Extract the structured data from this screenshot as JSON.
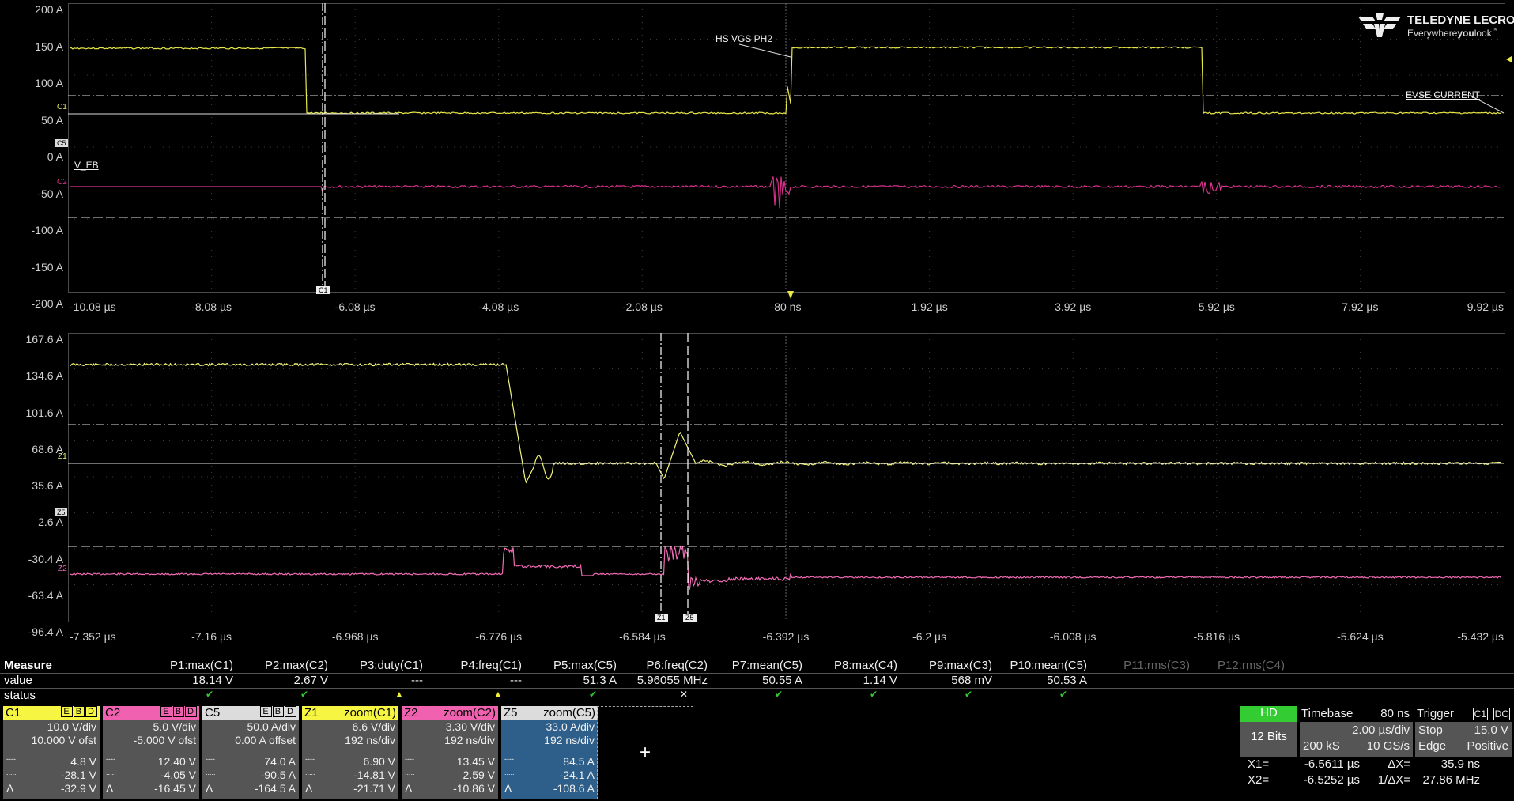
{
  "upper": {
    "y_labels": [
      "200 A",
      "150 A",
      "100 A",
      "50 A",
      "0 A",
      "-50 A",
      "-100 A",
      "-150 A",
      "-200 A"
    ],
    "x_labels": [
      "-10.08 µs",
      "-8.08 µs",
      "-6.08 µs",
      "-4.08 µs",
      "-2.08 µs",
      "-80 ns",
      "1.92 µs",
      "3.92 µs",
      "5.92 µs",
      "7.92 µs",
      "9.92 µs"
    ],
    "trace_labels": {
      "c1": "C1",
      "c5": "C5",
      "c2": "C2",
      "cursor": "C1"
    },
    "annotations": {
      "hs_vgs": "HS VGS PH2",
      "evse": "EVSE CURRENT",
      "v_eb": "V_EB"
    }
  },
  "lower": {
    "y_labels": [
      "167.6 A",
      "134.6 A",
      "101.6 A",
      "68.6 A",
      "35.6 A",
      "2.6 A",
      "-30.4 A",
      "-63.4 A",
      "-96.4 A"
    ],
    "x_labels": [
      "-7.352 µs",
      "-7.16 µs",
      "-6.968 µs",
      "-6.776 µs",
      "-6.584 µs",
      "-6.392 µs",
      "-6.2 µs",
      "-6.008 µs",
      "-5.816 µs",
      "-5.624 µs",
      "-5.432 µs"
    ],
    "trace_labels": {
      "z1": "Z1",
      "z5": "Z5",
      "z2": "Z2",
      "cur1": "Z1",
      "cur2": "Z5"
    }
  },
  "logo": {
    "name": "TELEDYNE LECROY",
    "tag_a": "Everywhere",
    "tag_b": "you",
    "tag_c": "look",
    "tm": "™"
  },
  "measure": {
    "rows": {
      "title": "Measure",
      "value": "value",
      "status": "status"
    },
    "params": [
      {
        "name": "P1:max(C1)",
        "value": "18.14 V",
        "status": "ok"
      },
      {
        "name": "P2:max(C2)",
        "value": "2.67 V",
        "status": "ok"
      },
      {
        "name": "P3:duty(C1)",
        "value": "---",
        "status": "warn"
      },
      {
        "name": "P4:freq(C1)",
        "value": "---",
        "status": "warn"
      },
      {
        "name": "P5:max(C5)",
        "value": "51.3 A",
        "status": "ok"
      },
      {
        "name": "P6:freq(C2)",
        "value": "5.96055 MHz",
        "status": "x"
      },
      {
        "name": "P7:mean(C5)",
        "value": "50.55 A",
        "status": "ok"
      },
      {
        "name": "P8:max(C4)",
        "value": "1.14 V",
        "status": "ok"
      },
      {
        "name": "P9:max(C3)",
        "value": "568 mV",
        "status": "ok"
      },
      {
        "name": "P10:mean(C5)",
        "value": "50.53 A",
        "status": "ok"
      },
      {
        "name": "P11:rms(C3)",
        "value": "",
        "status": ""
      },
      {
        "name": "P12:rms(C4)",
        "value": "",
        "status": ""
      }
    ]
  },
  "channels": [
    {
      "name": "C1",
      "ebd": [
        "E",
        "B",
        "D"
      ],
      "l1": "10.0 V/div",
      "l2": "10.000 V ofst",
      "c1": "4.8 V",
      "c2": "-28.1 V",
      "d": "-32.9 V",
      "color": "#f5f542",
      "textcolor": "#000"
    },
    {
      "name": "C2",
      "ebd": [
        "E",
        "B",
        "D"
      ],
      "l1": "5.0 V/div",
      "l2": "-5.000 V ofst",
      "c1": "12.40 V",
      "c2": "-4.05 V",
      "d": "-16.45 V",
      "color": "#f062b0",
      "textcolor": "#000"
    },
    {
      "name": "C5",
      "ebd": [
        "E",
        "B",
        "D"
      ],
      "l1": "50.0 A/div",
      "l2": "0.00 A offset",
      "c1": "74.0 A",
      "c2": "-90.5 A",
      "d": "-164.5 A",
      "color": "#dcdcdc",
      "textcolor": "#000"
    },
    {
      "name": "Z1",
      "ebd": [],
      "src": "zoom(C1)",
      "l1": "6.6 V/div",
      "l2": "192 ns/div",
      "c1": "6.90 V",
      "c2": "-14.81 V",
      "d": "-21.71 V",
      "color": "#f5f542",
      "textcolor": "#000"
    },
    {
      "name": "Z2",
      "ebd": [],
      "src": "zoom(C2)",
      "l1": "3.30 V/div",
      "l2": "192 ns/div",
      "c1": "13.45 V",
      "c2": "2.59 V",
      "d": "-10.86 V",
      "color": "#f062b0",
      "textcolor": "#000"
    },
    {
      "name": "Z5",
      "ebd": [],
      "src": "zoom(C5)",
      "l1": "33.0 A/div",
      "l2": "192 ns/div",
      "c1": "84.5 A",
      "c2": "-24.1 A",
      "d": "-108.6 A",
      "color": "#dcdcdc",
      "textcolor": "#000"
    }
  ],
  "cursor_glyphs": {
    "c1": "----",
    "c2": ".....",
    "d": "Δ"
  },
  "add_symbol": "+",
  "hd": {
    "label": "HD",
    "bits": "12 Bits"
  },
  "timebase": {
    "label": "Timebase",
    "delay": "80 ns",
    "per_div": "2.00 µs/div",
    "samples": "200 kS",
    "rate": "10 GS/s"
  },
  "trigger": {
    "label": "Trigger",
    "source": "C1",
    "coupling": "DC",
    "mode": "Stop",
    "level": "15.0 V",
    "type": "Edge",
    "slope": "Positive"
  },
  "cursors": {
    "x1_label": "X1=",
    "x1": "-6.5611 µs",
    "dx_label": "ΔX=",
    "dx": "35.9 ns",
    "x2_label": "X2=",
    "x2": "-6.5252 µs",
    "inv_label": "1/ΔX=",
    "inv": "27.86 MHz"
  },
  "colors": {
    "c1": "#e8e84a",
    "c2": "#d8318c",
    "z1": "#f4f47a",
    "z2": "#f06cb4",
    "grid": "#4a4a4a"
  }
}
